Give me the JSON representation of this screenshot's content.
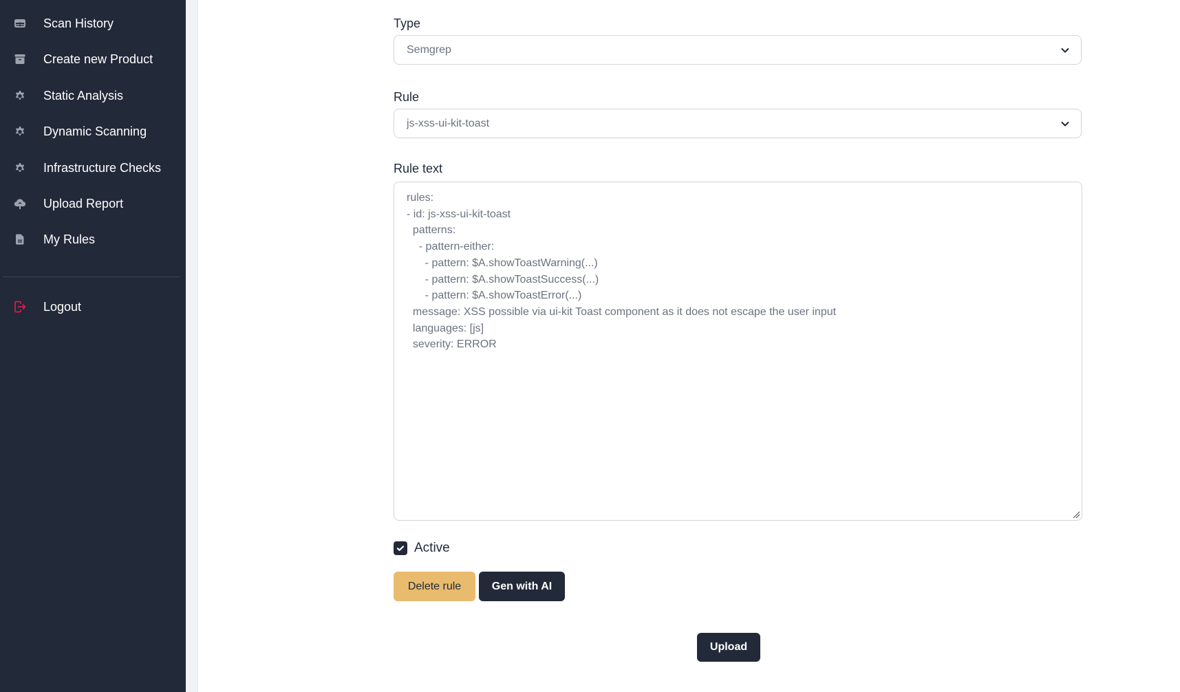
{
  "sidebar": {
    "items": [
      {
        "label": "Scan History",
        "icon": "table-icon"
      },
      {
        "label": "Create new Product",
        "icon": "archive-box-icon"
      },
      {
        "label": "Static Analysis",
        "icon": "gear-icon"
      },
      {
        "label": "Dynamic Scanning",
        "icon": "gear-icon"
      },
      {
        "label": "Infrastructure Checks",
        "icon": "gear-icon"
      },
      {
        "label": "Upload Report",
        "icon": "cloud-upload-icon"
      },
      {
        "label": "My Rules",
        "icon": "document-icon"
      }
    ],
    "logout": {
      "label": "Logout",
      "icon": "logout-icon",
      "color": "#e0194c"
    }
  },
  "form": {
    "type": {
      "label": "Type",
      "value": "Semgrep"
    },
    "rule": {
      "label": "Rule",
      "value": "js-xss-ui-kit-toast"
    },
    "rule_text": {
      "label": "Rule text",
      "value": "rules:\n- id: js-xss-ui-kit-toast\n  patterns:\n    - pattern-either:\n      - pattern: $A.showToastWarning(...)\n      - pattern: $A.showToastSuccess(...)\n      - pattern: $A.showToastError(...)\n  message: XSS possible via ui-kit Toast component as it does not escape the user input\n  languages: [js]\n  severity: ERROR"
    },
    "active": {
      "label": "Active",
      "checked": true
    },
    "buttons": {
      "delete": "Delete rule",
      "gen_ai": "Gen with AI",
      "upload": "Upload"
    }
  },
  "colors": {
    "sidebar_bg": "#222938",
    "delete_button": "#e9bb6e",
    "primary_button": "#222938",
    "logout_accent": "#e0194c"
  }
}
